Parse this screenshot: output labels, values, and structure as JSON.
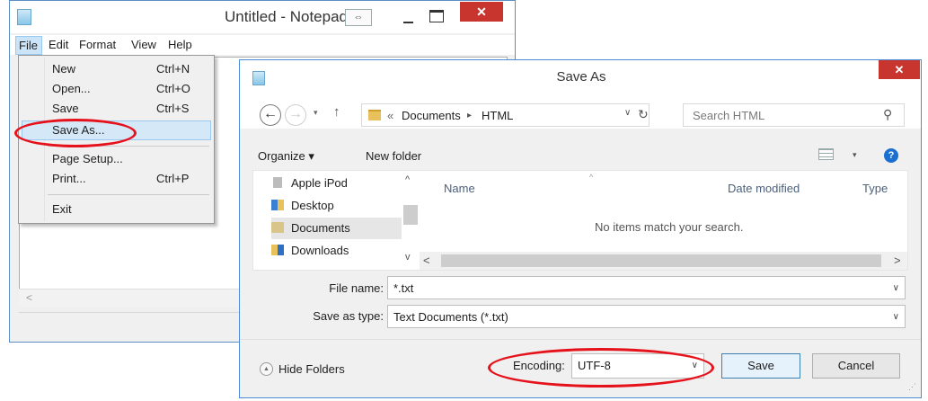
{
  "notepad": {
    "title": "Untitled - Notepad",
    "resize_glyph": "⇔",
    "close_glyph": "✕",
    "scroll_left_glyph": "<",
    "menu": [
      "File",
      "Edit",
      "Format",
      "View",
      "Help"
    ]
  },
  "file_menu": {
    "items": [
      {
        "label": "New",
        "shortcut": "Ctrl+N"
      },
      {
        "label": "Open...",
        "shortcut": "Ctrl+O"
      },
      {
        "label": "Save",
        "shortcut": "Ctrl+S"
      },
      {
        "label": "Save As...",
        "shortcut": ""
      },
      {
        "label": "Page Setup...",
        "shortcut": ""
      },
      {
        "label": "Print...",
        "shortcut": "Ctrl+P"
      },
      {
        "label": "Exit",
        "shortcut": ""
      }
    ],
    "highlighted": "Save As..."
  },
  "dialog": {
    "title": "Save As",
    "close_glyph": "✕",
    "nav": {
      "back": "←",
      "forward": "→",
      "recent": "▾",
      "up": "↑"
    },
    "address": {
      "overflow": "«",
      "crumbs": [
        "Documents",
        "HTML"
      ],
      "separator": "▸",
      "dropdown": "∨",
      "refresh": "↻"
    },
    "search": {
      "placeholder": "Search HTML",
      "icon": "⚲"
    },
    "toolbar": {
      "organize": "Organize ▾",
      "new_folder": "New folder",
      "view_dropdown": "▾",
      "help": "?"
    },
    "nav_pane": [
      {
        "label": "Apple iPod",
        "icon": "ipod-icon"
      },
      {
        "label": "Desktop",
        "icon": "desktop-folder-icon"
      },
      {
        "label": "Documents",
        "icon": "documents-folder-icon"
      },
      {
        "label": "Downloads",
        "icon": "downloads-folder-icon"
      }
    ],
    "scroll_glyphs": {
      "up": "^",
      "down": "v",
      "left": "<",
      "right": ">",
      "sort": "^"
    },
    "columns": [
      "Name",
      "Date modified",
      "Type"
    ],
    "empty_message": "No items match your search.",
    "file_name": {
      "label": "File name:",
      "value": "*.txt"
    },
    "save_as_type": {
      "label": "Save as type:",
      "value": "Text Documents (*.txt)"
    },
    "combo_arrow": "∨",
    "hide_folders": {
      "label": "Hide Folders",
      "icon": "▲"
    },
    "encoding": {
      "label": "Encoding:",
      "value": "UTF-8"
    },
    "buttons": {
      "save": "Save",
      "cancel": "Cancel"
    },
    "grip": "⋰"
  },
  "colors": {
    "highlight_oval": "#e6121b",
    "close_button": "#c7352e",
    "window_border": "#4a8cd6",
    "menu_highlight": "#d5e8f8"
  }
}
